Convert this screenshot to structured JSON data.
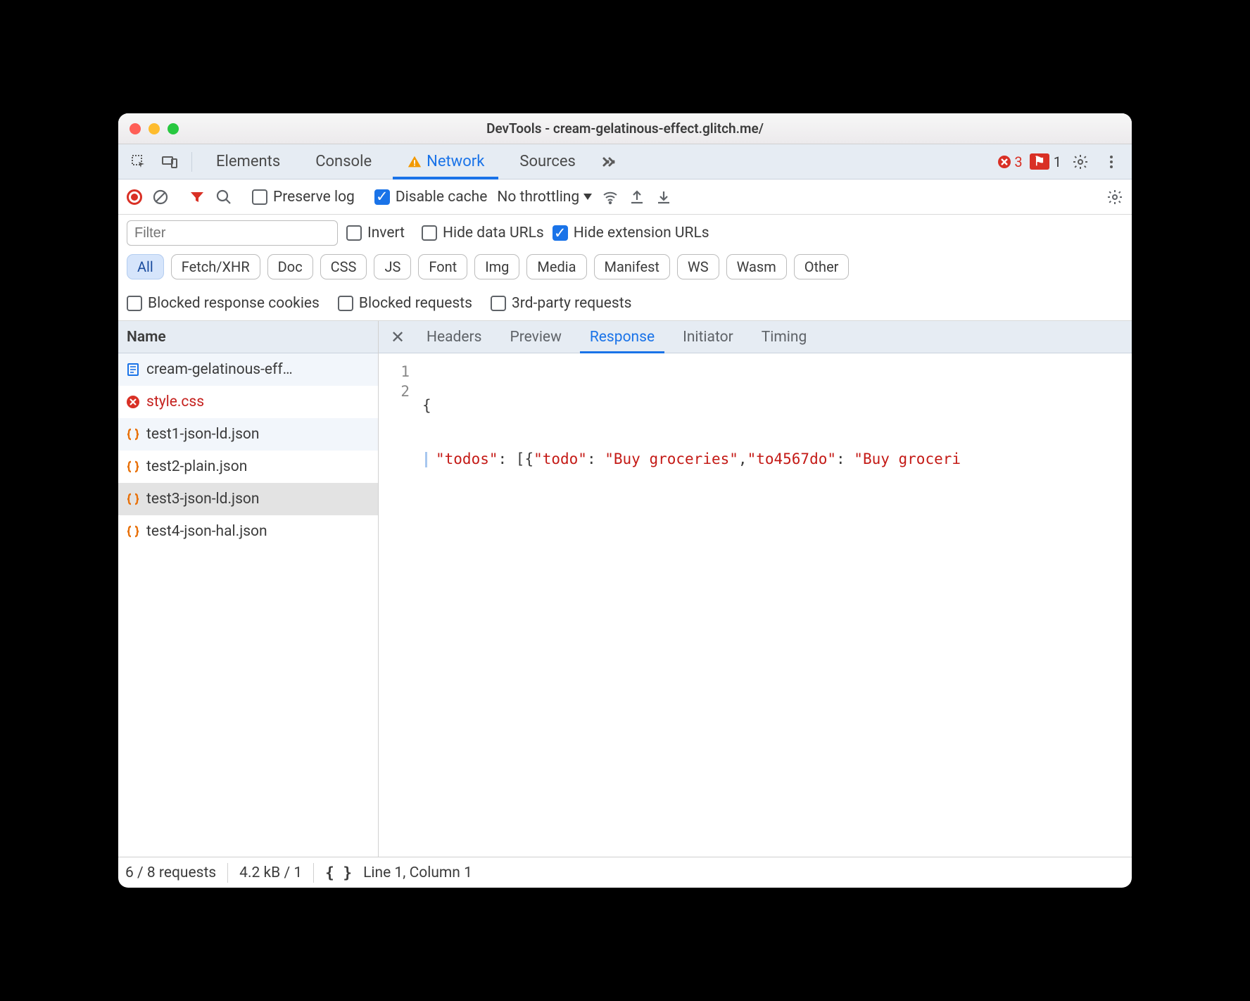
{
  "window": {
    "title": "DevTools - cream-gelatinous-effect.glitch.me/"
  },
  "tabs": {
    "items": [
      "Elements",
      "Console",
      "Network",
      "Sources"
    ],
    "active": "Network",
    "errors_count": "3",
    "issues_count": "1"
  },
  "toolbar": {
    "preserve_log_label": "Preserve log",
    "preserve_log_checked": false,
    "disable_cache_label": "Disable cache",
    "disable_cache_checked": true,
    "throttling_label": "No throttling"
  },
  "filter": {
    "placeholder": "Filter",
    "invert_label": "Invert",
    "invert_checked": false,
    "hide_data_label": "Hide data URLs",
    "hide_data_checked": false,
    "hide_ext_label": "Hide extension URLs",
    "hide_ext_checked": true,
    "types": [
      "All",
      "Fetch/XHR",
      "Doc",
      "CSS",
      "JS",
      "Font",
      "Img",
      "Media",
      "Manifest",
      "WS",
      "Wasm",
      "Other"
    ],
    "type_active": "All",
    "blocked_cookies_label": "Blocked response cookies",
    "blocked_requests_label": "Blocked requests",
    "third_party_label": "3rd-party requests"
  },
  "requests": {
    "header": "Name",
    "items": [
      {
        "name": "cream-gelatinous-eff…",
        "icon": "document",
        "error": false
      },
      {
        "name": "style.css",
        "icon": "error",
        "error": true
      },
      {
        "name": "test1-json-ld.json",
        "icon": "json",
        "error": false
      },
      {
        "name": "test2-plain.json",
        "icon": "json",
        "error": false
      },
      {
        "name": "test3-json-ld.json",
        "icon": "json",
        "error": false,
        "selected": true
      },
      {
        "name": "test4-json-hal.json",
        "icon": "json",
        "error": false
      }
    ]
  },
  "detail_tabs": {
    "items": [
      "Headers",
      "Preview",
      "Response",
      "Initiator",
      "Timing"
    ],
    "active": "Response"
  },
  "response": {
    "lines": [
      "1",
      "2"
    ],
    "code_line1": "{",
    "code_line2_parts": {
      "k1": "\"todos\"",
      "p1": ": [{",
      "k2": "\"todo\"",
      "p2": ": ",
      "v1": "\"Buy groceries\"",
      "p3": ",",
      "k3": "\"to4567do\"",
      "p4": ": ",
      "v2": "\"Buy groceri"
    }
  },
  "status": {
    "requests": "6 / 8 requests",
    "transferred": "4.2 kB / 1",
    "cursor": "Line 1, Column 1"
  }
}
